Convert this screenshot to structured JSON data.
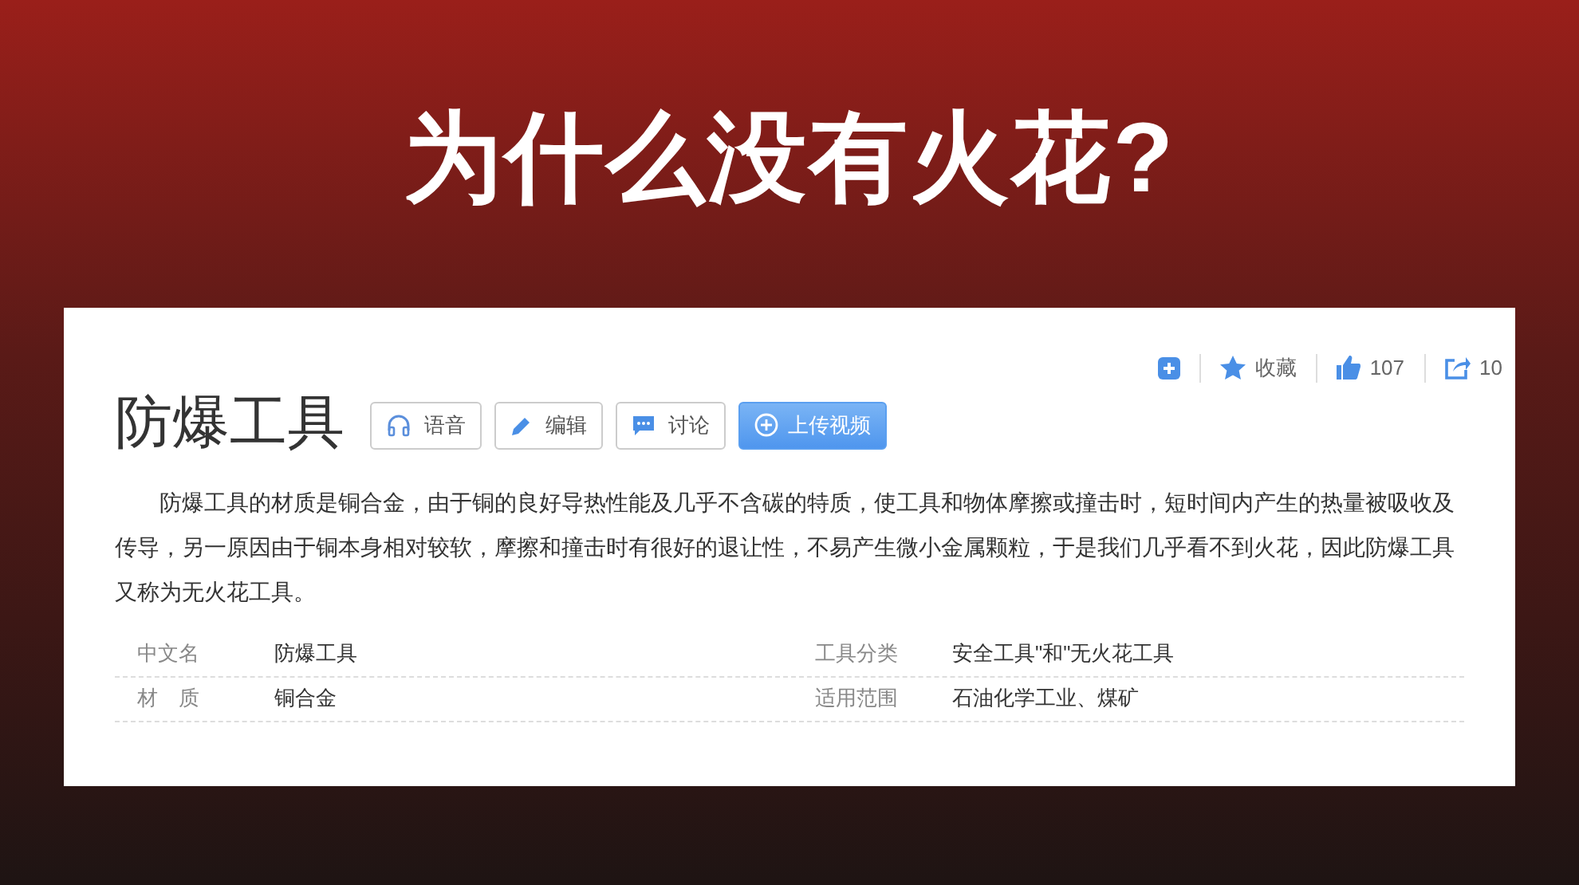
{
  "slide_title": "为什么没有火花?",
  "entry": {
    "title": "防爆工具",
    "buttons": [
      {
        "kind": "audio",
        "label": "语音"
      },
      {
        "kind": "edit",
        "label": "编辑"
      },
      {
        "kind": "discuss",
        "label": "讨论"
      },
      {
        "kind": "upload",
        "label": "上传视频"
      }
    ],
    "actions": [
      {
        "kind": "add"
      },
      {
        "kind": "favorite",
        "label": "收藏"
      },
      {
        "kind": "like",
        "label": "107"
      },
      {
        "kind": "share",
        "label": "10"
      }
    ],
    "summary": "防爆工具的材质是铜合金，由于铜的良好导热性能及几乎不含碳的特质，使工具和物体摩擦或撞击时，短时间内产生的热量被吸收及传导，另一原因由于铜本身相对较软，摩擦和撞击时有很好的退让性，不易产生微小金属颗粒，于是我们几乎看不到火花，因此防爆工具又称为无火花工具。",
    "info": [
      [
        {
          "name": "中文名",
          "value": "防爆工具"
        },
        {
          "name": "工具分类",
          "value": "安全工具\"和\"无火花工具"
        }
      ],
      [
        {
          "name": "材　质",
          "value": "铜合金"
        },
        {
          "name": "适用范围",
          "value": "石油化学工业、煤矿"
        }
      ]
    ]
  }
}
